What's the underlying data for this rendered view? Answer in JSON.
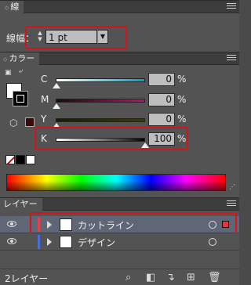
{
  "stroke_panel": {
    "tab_label": "線",
    "weight_label": "線幅：",
    "weight_value": "1 pt"
  },
  "color_panel": {
    "tab_label": "カラー",
    "channels": [
      {
        "label": "C",
        "value": "0",
        "unit": "%",
        "fill": 0
      },
      {
        "label": "M",
        "value": "0",
        "unit": "%",
        "fill": 0
      },
      {
        "label": "Y",
        "value": "0",
        "unit": "%",
        "fill": 0
      },
      {
        "label": "K",
        "value": "100",
        "unit": "%",
        "fill": 1.0
      }
    ],
    "colors": {
      "slider_c": "#00a0c0",
      "slider_m": "#c0106a",
      "slider_y": "#c8b400",
      "highlight": "#d4141b"
    }
  },
  "layers_panel": {
    "tab_label": "レイヤー",
    "layers": [
      {
        "name": "カットライン",
        "color": "#e8404a",
        "selected": true
      },
      {
        "name": "デザイン",
        "color": "#4a6ee0",
        "selected": false
      }
    ],
    "count_label": "2レイヤー",
    "footer_icons": [
      "search-icon",
      "make-clipping-mask-icon",
      "new-sublayer-icon",
      "new-layer-icon",
      "delete-icon"
    ]
  }
}
